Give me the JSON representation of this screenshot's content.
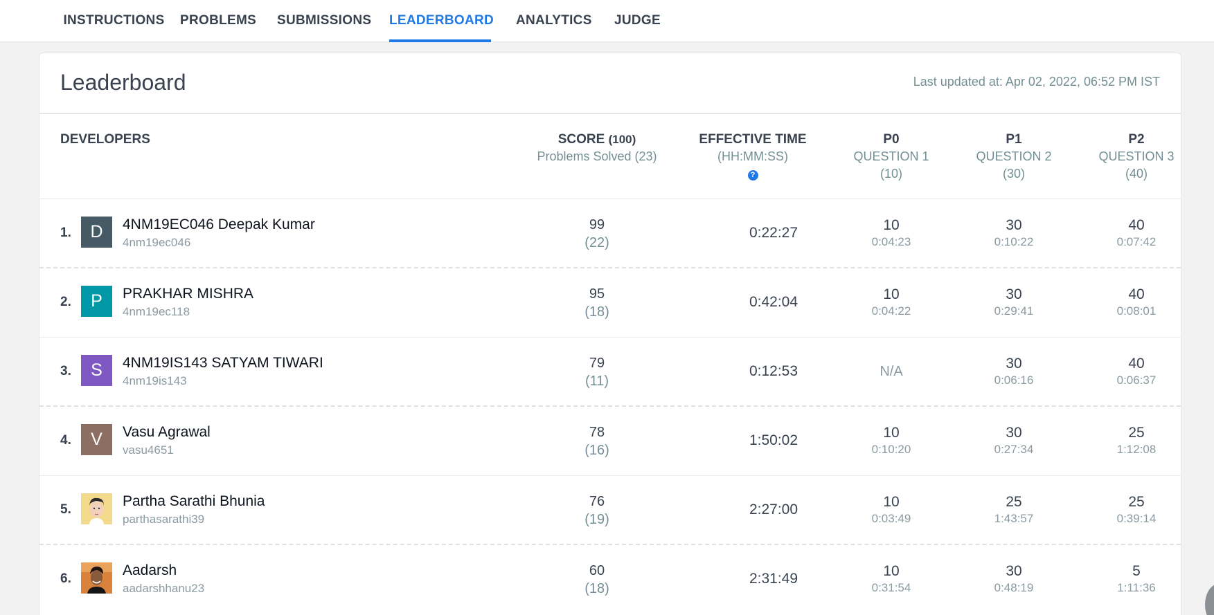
{
  "nav": {
    "tabs": [
      {
        "label": "INSTRUCTIONS",
        "active": false
      },
      {
        "label": "PROBLEMS",
        "active": false
      },
      {
        "label": "SUBMISSIONS",
        "active": false
      },
      {
        "label": "LEADERBOARD",
        "active": true
      },
      {
        "label": "ANALYTICS",
        "active": false
      },
      {
        "label": "JUDGE",
        "active": false
      }
    ]
  },
  "leaderboard": {
    "title": "Leaderboard",
    "last_updated": "Last updated at: Apr 02, 2022, 06:52 PM IST",
    "headers": {
      "developers": "DEVELOPERS",
      "score": "SCORE",
      "score_max": "(100)",
      "problems_solved": "Problems Solved (23)",
      "effective_time": "EFFECTIVE TIME",
      "time_format": "(HH:MM:SS)",
      "help_icon": "question-circle-icon",
      "p0": {
        "code": "P0",
        "name": "QUESTION 1",
        "points": "(10)"
      },
      "p1": {
        "code": "P1",
        "name": "QUESTION 2",
        "points": "(30)"
      },
      "p2": {
        "code": "P2",
        "name": "QUESTION 3",
        "points": "(40)"
      }
    },
    "rows": [
      {
        "rank": "1.",
        "avatar_letter": "D",
        "avatar_color": "#455a64",
        "name": "4NM19EC046 Deepak Kumar",
        "username": "4nm19ec046",
        "score": "99",
        "solved": "(22)",
        "time": "0:22:27",
        "p0": {
          "score": "10",
          "time": "0:04:23"
        },
        "p1": {
          "score": "30",
          "time": "0:10:22"
        },
        "p2": {
          "score": "40",
          "time": "0:07:42"
        }
      },
      {
        "rank": "2.",
        "avatar_letter": "P",
        "avatar_color": "#0097a7",
        "name": "PRAKHAR MISHRA",
        "username": "4nm19ec118",
        "score": "95",
        "solved": "(18)",
        "time": "0:42:04",
        "p0": {
          "score": "10",
          "time": "0:04:22"
        },
        "p1": {
          "score": "30",
          "time": "0:29:41"
        },
        "p2": {
          "score": "40",
          "time": "0:08:01"
        }
      },
      {
        "rank": "3.",
        "avatar_letter": "S",
        "avatar_color": "#7e57c2",
        "name": "4NM19IS143 SATYAM TIWARI",
        "username": "4nm19is143",
        "score": "79",
        "solved": "(11)",
        "time": "0:12:53",
        "p0": {
          "na": "N/A"
        },
        "p1": {
          "score": "30",
          "time": "0:06:16"
        },
        "p2": {
          "score": "40",
          "time": "0:06:37"
        }
      },
      {
        "rank": "4.",
        "avatar_letter": "V",
        "avatar_color": "#8d6e63",
        "name": "Vasu Agrawal",
        "username": "vasu4651",
        "score": "78",
        "solved": "(16)",
        "time": "1:50:02",
        "p0": {
          "score": "10",
          "time": "0:10:20"
        },
        "p1": {
          "score": "30",
          "time": "0:27:34"
        },
        "p2": {
          "score": "25",
          "time": "1:12:08"
        }
      },
      {
        "rank": "5.",
        "avatar_letter": "",
        "avatar_color": "#f3d98c",
        "name": "Partha Sarathi Bhunia",
        "username": "parthasarathi39",
        "score": "76",
        "solved": "(19)",
        "time": "2:27:00",
        "p0": {
          "score": "10",
          "time": "0:03:49"
        },
        "p1": {
          "score": "25",
          "time": "1:43:57"
        },
        "p2": {
          "score": "25",
          "time": "0:39:14"
        }
      },
      {
        "rank": "6.",
        "avatar_letter": "",
        "avatar_color": "#d9823b",
        "name": "Aadarsh",
        "username": "aadarshhanu23",
        "score": "60",
        "solved": "(18)",
        "time": "2:31:49",
        "p0": {
          "score": "10",
          "time": "0:31:54"
        },
        "p1": {
          "score": "30",
          "time": "0:48:19"
        },
        "p2": {
          "score": "5",
          "time": "1:11:36"
        }
      }
    ]
  }
}
